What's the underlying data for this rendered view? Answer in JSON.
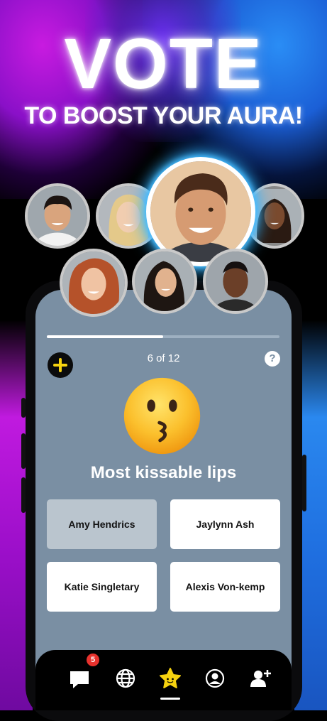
{
  "promo": {
    "headline": "VOTE",
    "subheadline": "TO BOOST YOUR AURA!"
  },
  "avatars": [
    {
      "name": "avatar-asian-man"
    },
    {
      "name": "avatar-blonde-woman"
    },
    {
      "name": "avatar-featured-man"
    },
    {
      "name": "avatar-woman-braids"
    },
    {
      "name": "avatar-redhead-woman"
    },
    {
      "name": "avatar-darkhair-woman"
    },
    {
      "name": "avatar-young-man"
    }
  ],
  "poll": {
    "progress_fraction": 0.5,
    "counter": "6 of 12",
    "question_emoji": "kissing-face",
    "question": "Most kissable lips",
    "options": [
      {
        "label": "Amy Hendrics",
        "selected": true
      },
      {
        "label": "Jaylynn Ash",
        "selected": false
      },
      {
        "label": "Katie Singletary",
        "selected": false
      },
      {
        "label": "Alexis Von-kemp",
        "selected": false
      }
    ],
    "help_label": "?"
  },
  "tabbar": {
    "items": [
      {
        "icon": "message-icon",
        "badge": "5"
      },
      {
        "icon": "globe-icon"
      },
      {
        "icon": "star-icon",
        "active": true
      },
      {
        "icon": "profile-icon"
      },
      {
        "icon": "add-friend-icon"
      }
    ]
  },
  "colors": {
    "screen_bg": "#7a8fa3",
    "accent_yellow": "#f6d20f",
    "glow_blue": "#2fb2ff",
    "badge_red": "#e8322d"
  }
}
